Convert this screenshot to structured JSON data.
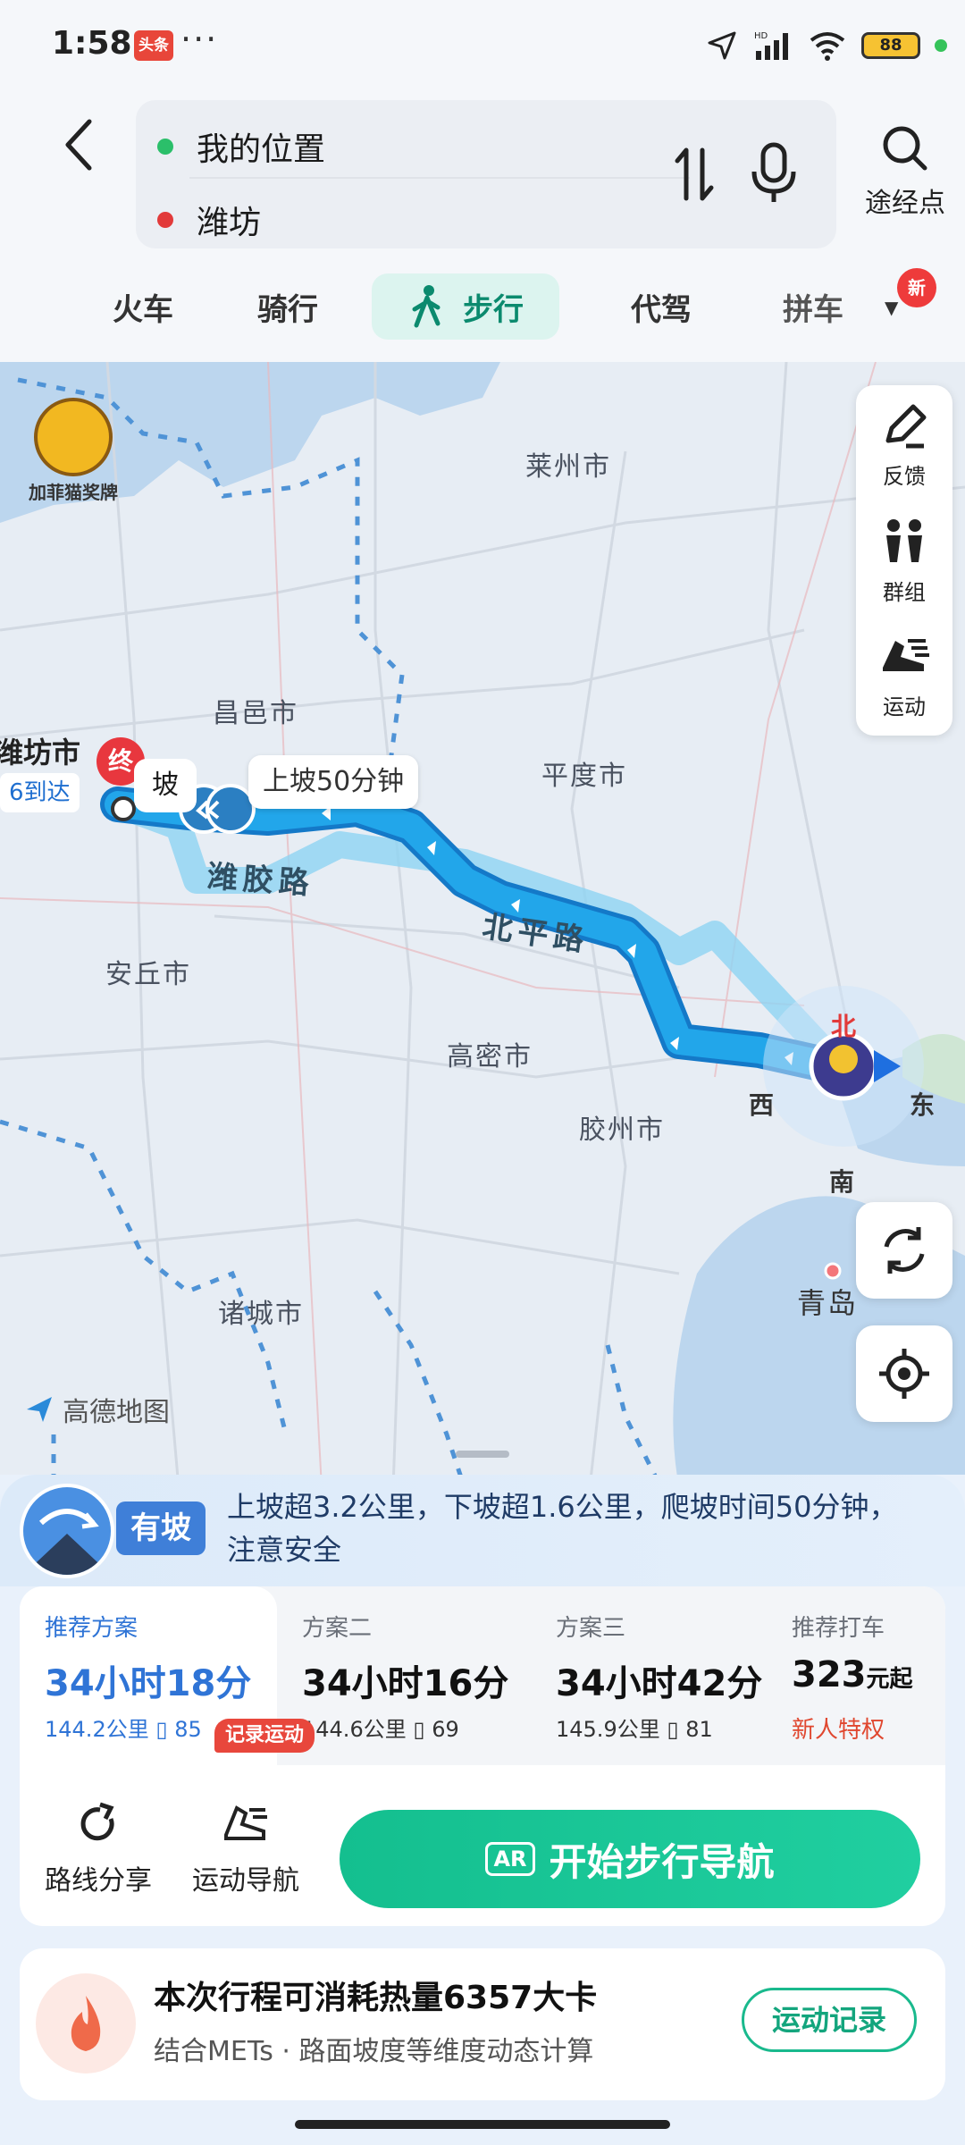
{
  "status_bar": {
    "time": "1:58",
    "news_badge": "头条",
    "overflow": "···",
    "battery": "88"
  },
  "search": {
    "origin": "我的位置",
    "destination": "潍坊",
    "waypoint_label": "途经点"
  },
  "tabs": {
    "items": [
      {
        "label": "火车"
      },
      {
        "label": "骑行"
      },
      {
        "label": "步行"
      },
      {
        "label": "代驾"
      },
      {
        "label": "拼车"
      }
    ],
    "new_badge": "新"
  },
  "map": {
    "cities": {
      "laizhou": "莱州市",
      "changyi": "昌邑市",
      "pingdu": "平度市",
      "anqiu": "安丘市",
      "gaomi": "高密市",
      "jiaozhou": "胶州市",
      "zhucheng": "诸城市",
      "qingdao": "青岛",
      "weifang_edge": "潍坊市"
    },
    "edge_eta": "6到达",
    "end_marker": "终",
    "slope_left": "坡",
    "slope_bubble": "上坡50分钟",
    "roads": {
      "weijiao": "潍胶路",
      "beiping": "北平路"
    },
    "compass": {
      "north": "北",
      "south": "南",
      "east": "东",
      "west": "西"
    },
    "logo_text": "加菲猫奖牌",
    "amap_brand": "高德地图",
    "tools": {
      "feedback": "反馈",
      "group": "群组",
      "sport": "运动"
    }
  },
  "slope": {
    "tag": "有坡",
    "text": "上坡超3.2公里，下坡超1.6公里，爬坡时间50分钟，注意安全"
  },
  "plans": [
    {
      "name": "推荐方案",
      "time": "34小时18分",
      "distance": "144.2公里",
      "lights": "85"
    },
    {
      "name": "方案二",
      "time": "34小时16分",
      "distance": "144.6公里",
      "lights": "69"
    },
    {
      "name": "方案三",
      "time": "34小时42分",
      "distance": "145.9公里",
      "lights": "81"
    }
  ],
  "taxi": {
    "name": "推荐打车",
    "price": "323",
    "price_unit": "元起",
    "promo": "新人特权"
  },
  "actions": {
    "share": "路线分享",
    "sport_nav": "运动导航",
    "record_tag": "记录运动",
    "start_nav": "开始步行导航",
    "ar": "AR"
  },
  "calorie": {
    "title": "本次行程可消耗热量6357大卡",
    "subtitle": "结合METs · 路面坡度等维度动态计算",
    "button": "运动记录"
  },
  "colors": {
    "accent_green": "#14bf8f",
    "route_blue": "#1ea0e6",
    "active_blue": "#2f74d6",
    "promo_red": "#e0472f"
  }
}
